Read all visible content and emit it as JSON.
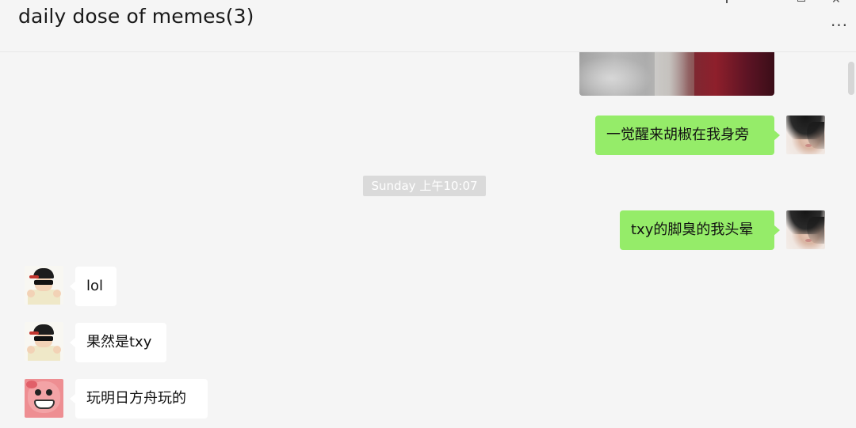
{
  "header": {
    "title": "daily dose of memes(3)",
    "more_label": "···"
  },
  "window_controls": {
    "close_label": "✕"
  },
  "timestamp": "Sunday 上午10:07",
  "messages": [
    {
      "side": "out",
      "text": "一觉醒来胡椒在我身旁",
      "avatar": "self-avatar"
    },
    {
      "side": "out",
      "text": "txy的脚臭的我头晕",
      "avatar": "self-avatar"
    },
    {
      "side": "in",
      "text": "lol",
      "avatar": "kid-avatar"
    },
    {
      "side": "in",
      "text": "果然是txy",
      "avatar": "kid-avatar"
    },
    {
      "side": "in",
      "text": "玩明日方舟玩的",
      "avatar": "pig-avatar"
    }
  ],
  "colors": {
    "outgoing_bubble": "#95ec69",
    "incoming_bubble": "#ffffff",
    "background": "#f5f5f5",
    "timestamp_bg": "#dadada"
  }
}
